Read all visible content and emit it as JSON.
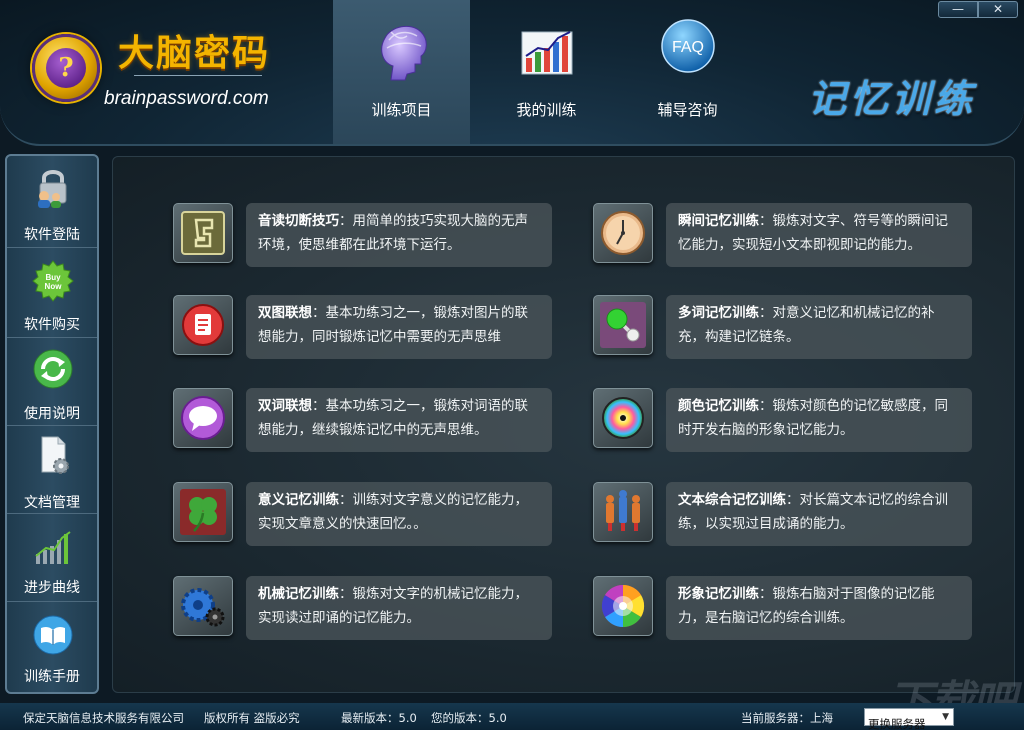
{
  "header": {
    "brand_title": "大脑密码",
    "brand_url": "brainpassword.com",
    "brand_logo_text": "?",
    "section_title": "记忆训练",
    "tabs": [
      {
        "label": "训练项目",
        "icon": "brain-head-icon",
        "active": true
      },
      {
        "label": "我的训练",
        "icon": "bar-chart-icon",
        "active": false
      },
      {
        "label": "辅导咨询",
        "icon": "faq-icon",
        "active": false,
        "icon_text": "FAQ"
      }
    ],
    "window": {
      "minimize": "—",
      "close": "✕"
    }
  },
  "sidebar": {
    "items": [
      {
        "label": "软件登陆",
        "icon": "lock-users-icon"
      },
      {
        "label": "软件购买",
        "icon": "buy-now-icon",
        "icon_text": "Buy Now"
      },
      {
        "label": "使用说明",
        "icon": "refresh-icon"
      },
      {
        "label": "文档管理",
        "icon": "document-gear-icon"
      },
      {
        "label": "进步曲线",
        "icon": "progress-chart-icon"
      },
      {
        "label": "训练手册",
        "icon": "book-icon"
      }
    ]
  },
  "cards": [
    {
      "title": "音读切断技巧",
      "desc": "：用简单的技巧实现大脑的无声环境，使思维都在此环境下运行。",
      "icon": "ear-symbol-icon"
    },
    {
      "title": "瞬间记忆训练",
      "desc": "：锻炼对文字、符号等的瞬间记忆能力，实现短小文本即视即记的能力。",
      "icon": "clock-icon"
    },
    {
      "title": "双图联想",
      "desc": "：基本功练习之一，锻炼对图片的联想能力，同时锻炼记忆中需要的无声思维",
      "icon": "red-notebook-icon"
    },
    {
      "title": "多词记忆训练",
      "desc": "：对意义记忆和机械记忆的补充，构建记忆链条。",
      "icon": "molecule-icon"
    },
    {
      "title": "双词联想",
      "desc": "：基本功练习之一，锻炼对词语的联想能力，继续锻炼记忆中的无声思维。",
      "icon": "speech-bubble-icon"
    },
    {
      "title": "颜色记忆训练",
      "desc": "：锻炼对颜色的记忆敏感度，同时开发右脑的形象记忆能力。",
      "icon": "color-disc-icon"
    },
    {
      "title": "意义记忆训练",
      "desc": "：训练对文字意义的记忆能力，实现文章意义的快速回忆。。",
      "icon": "clover-icon"
    },
    {
      "title": "文本综合记忆训练",
      "desc": "：对长篇文本记忆的综合训练，以实现过目成诵的能力。",
      "icon": "robot-figures-icon"
    },
    {
      "title": "机械记忆训练",
      "desc": "：锻炼对文字的机械记忆能力，实现读过即诵的记忆能力。",
      "icon": "gears-icon"
    },
    {
      "title": "形象记忆训练",
      "desc": "：锻炼右脑对于图像的记忆能力，是右脑记忆的综合训练。",
      "icon": "color-wheel-icon"
    }
  ],
  "footer": {
    "company": "保定天脑信息技术服务有限公司",
    "copyright": "版权所有 盗版必究",
    "latest_version": "最新版本：5.0",
    "your_version": "您的版本：5.0",
    "current_server": "当前服务器：上海",
    "change_server": "更换服务器"
  },
  "watermark": "下载吧",
  "colors": {
    "brand_gold": "#f4b400",
    "section_blue": "#4aa8e8",
    "header_bg": "#102534",
    "card_bg": "#4a545a"
  }
}
